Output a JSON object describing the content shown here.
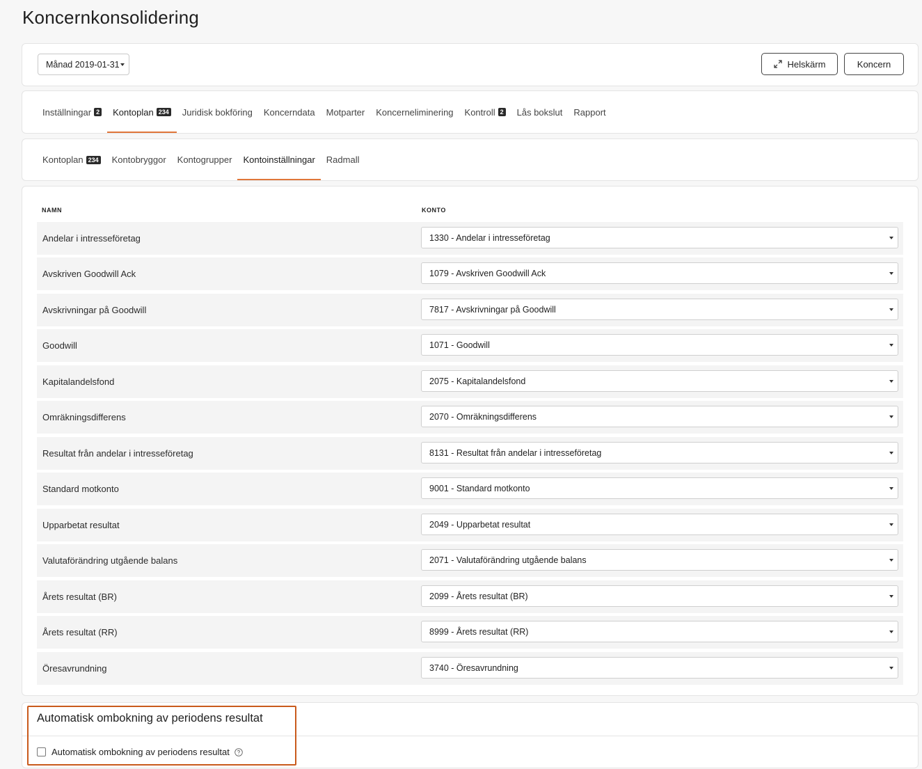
{
  "page": {
    "title": "Koncernkonsolidering"
  },
  "toolbar": {
    "period_label": "Månad 2019-01-31",
    "fullscreen_label": "Helskärm",
    "group_label": "Koncern"
  },
  "main_tabs": [
    {
      "label": "Inställningar",
      "badge": "2"
    },
    {
      "label": "Kontoplan",
      "badge": "234"
    },
    {
      "label": "Juridisk bokföring"
    },
    {
      "label": "Koncerndata"
    },
    {
      "label": "Motparter"
    },
    {
      "label": "Koncerneliminering"
    },
    {
      "label": "Kontroll",
      "badge": "2"
    },
    {
      "label": "Lås bokslut"
    },
    {
      "label": "Rapport"
    }
  ],
  "sub_tabs": [
    {
      "label": "Kontoplan",
      "badge": "234"
    },
    {
      "label": "Kontobryggor"
    },
    {
      "label": "Kontogrupper"
    },
    {
      "label": "Kontoinställningar"
    },
    {
      "label": "Radmall"
    }
  ],
  "table": {
    "col_name": "NAMN",
    "col_account": "KONTO",
    "rows": [
      {
        "name": "Andelar i intresseföretag",
        "account": "1330 - Andelar i intresseföretag"
      },
      {
        "name": "Avskriven Goodwill Ack",
        "account": "1079 - Avskriven Goodwill Ack"
      },
      {
        "name": "Avskrivningar på Goodwill",
        "account": "7817 - Avskrivningar på Goodwill"
      },
      {
        "name": "Goodwill",
        "account": "1071 - Goodwill"
      },
      {
        "name": "Kapitalandelsfond",
        "account": "2075 - Kapitalandelsfond"
      },
      {
        "name": "Omräkningsdifferens",
        "account": "2070 - Omräkningsdifferens"
      },
      {
        "name": "Resultat från andelar i intresseföretag",
        "account": "8131 - Resultat från andelar i intresseföretag"
      },
      {
        "name": "Standard motkonto",
        "account": "9001 - Standard motkonto"
      },
      {
        "name": "Upparbetat resultat",
        "account": "2049 - Upparbetat resultat"
      },
      {
        "name": "Valutaförändring utgående balans",
        "account": "2071 - Valutaförändring utgående balans"
      },
      {
        "name": "Årets resultat (BR)",
        "account": "2099 - Årets resultat (BR)"
      },
      {
        "name": "Årets resultat (RR)",
        "account": "8999 - Årets resultat (RR)"
      },
      {
        "name": "Öresavrundning",
        "account": "3740 - Öresavrundning"
      }
    ]
  },
  "auto_booking": {
    "title": "Automatisk ombokning av periodens resultat",
    "checkbox_label": "Automatisk ombokning av periodens resultat",
    "checked": false
  },
  "colors": {
    "accent": "#e0763a",
    "highlight": "#c95a1c"
  }
}
